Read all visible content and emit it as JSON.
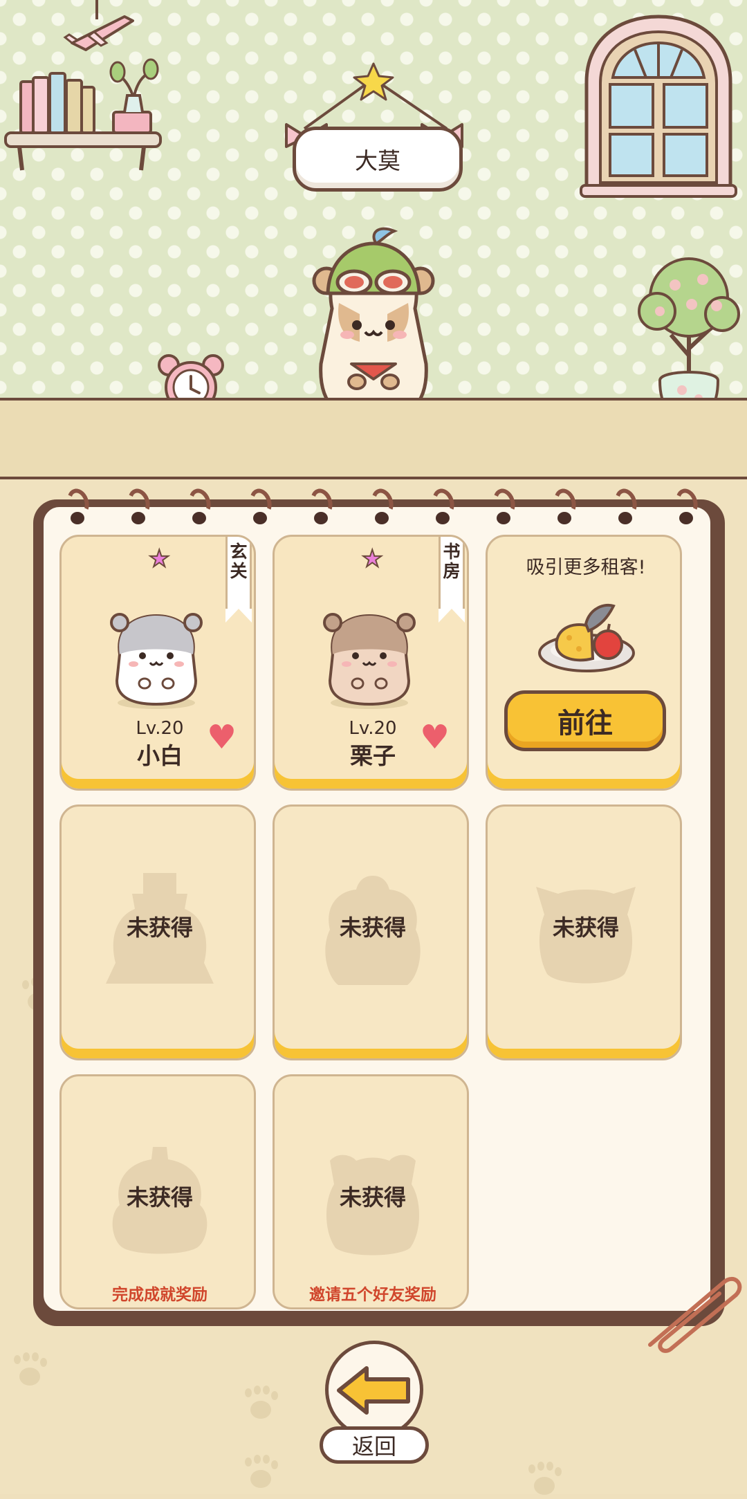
{
  "room": {
    "owner_name": "大莫"
  },
  "tenants": [
    {
      "level": "Lv.20",
      "name": "小白",
      "room": "玄关"
    },
    {
      "level": "Lv.20",
      "name": "栗子",
      "room": "书房"
    }
  ],
  "promo": {
    "text": "吸引更多租客!",
    "button_label": "前往"
  },
  "locked_slots": [
    {
      "label": "未获得",
      "reward_text": ""
    },
    {
      "label": "未获得",
      "reward_text": ""
    },
    {
      "label": "未获得",
      "reward_text": ""
    },
    {
      "label": "未获得",
      "reward_text": "完成成就奖励"
    },
    {
      "label": "未获得",
      "reward_text": "邀请五个好友奖励"
    }
  ],
  "back_button": {
    "label": "返回"
  },
  "colors": {
    "outline": "#6c4a3c",
    "card_bottom": "#f7c335",
    "button_yellow": "#f8c235",
    "heart": "#ec5f6c",
    "reward_text": "#d0462c"
  }
}
